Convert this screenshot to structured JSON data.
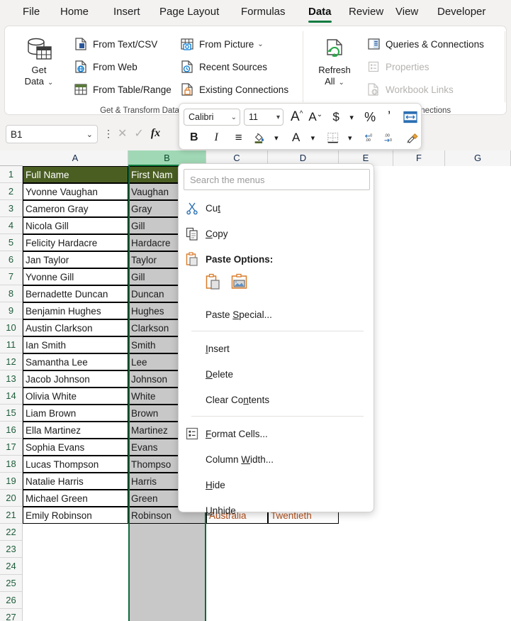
{
  "ribbon": {
    "tabs": [
      {
        "label": "File",
        "active": false
      },
      {
        "label": "Home",
        "active": false
      },
      {
        "label": "Insert",
        "active": false
      },
      {
        "label": "Page Layout",
        "active": false
      },
      {
        "label": "Formulas",
        "active": false
      },
      {
        "label": "Data",
        "active": true
      },
      {
        "label": "Review",
        "active": false
      },
      {
        "label": "View",
        "active": false
      },
      {
        "label": "Developer",
        "active": false
      }
    ],
    "groups": [
      {
        "label": "Get & Transform Data"
      },
      {
        "label": "Queries & Connections"
      }
    ],
    "get_data": {
      "line1": "Get",
      "line2": "Data",
      "chevron": "⌄",
      "icon": "get-data-icon"
    },
    "get_transform_items": [
      {
        "label": "From Text/CSV",
        "icon": "text-csv-icon",
        "disabled": false
      },
      {
        "label": "From Web",
        "icon": "web-icon",
        "disabled": false
      },
      {
        "label": "From Table/Range",
        "icon": "table-range-icon",
        "disabled": false
      },
      {
        "label": "From Picture",
        "icon": "picture-icon",
        "disabled": false,
        "chevron": "⌄"
      },
      {
        "label": "Recent Sources",
        "icon": "recent-sources-icon",
        "disabled": false
      },
      {
        "label": "Existing Connections",
        "icon": "existing-connections-icon",
        "disabled": false
      }
    ],
    "refresh_all": {
      "line1": "Refresh",
      "line2": "All",
      "chevron": "⌄",
      "icon": "refresh-icon"
    },
    "queries_items": [
      {
        "label": "Queries & Connections",
        "icon": "queries-connections-icon",
        "disabled": false
      },
      {
        "label": "Properties",
        "icon": "properties-icon",
        "disabled": true
      },
      {
        "label": "Workbook Links",
        "icon": "workbook-links-icon",
        "disabled": true
      }
    ]
  },
  "formula_bar": {
    "name_box_value": "B1",
    "name_box_chevron": "⌄",
    "cancel_icon": "close-icon",
    "confirm_icon": "check-icon",
    "function_icon": "fx",
    "formula_value": ""
  },
  "mini_toolbar": {
    "font_name": "Calibri",
    "font_size": "11",
    "chevron": "⌄",
    "row1": [
      {
        "name": "increase-font-size-button",
        "glyph": "A˄"
      },
      {
        "name": "decrease-font-size-button",
        "glyph": "Aˇ"
      },
      {
        "name": "accounting-number-format-button",
        "glyph": "$"
      },
      {
        "name": "accounting-format-dropdown",
        "glyph": "⌄"
      },
      {
        "name": "percent-style-button",
        "glyph": "%"
      },
      {
        "name": "comma-style-button",
        "glyph": "'"
      },
      {
        "name": "merge-and-center-button",
        "glyph": "↔"
      }
    ],
    "row2": [
      {
        "name": "bold-button",
        "glyph": "B"
      },
      {
        "name": "italic-button",
        "glyph": "I"
      },
      {
        "name": "align-button",
        "glyph": "≡"
      },
      {
        "name": "fill-color-button",
        "glyph": "◆"
      },
      {
        "name": "fill-color-dropdown",
        "glyph": "⌄"
      },
      {
        "name": "font-color-button",
        "glyph": "A"
      },
      {
        "name": "font-color-dropdown",
        "glyph": "⌄"
      },
      {
        "name": "borders-button",
        "glyph": "⊞"
      },
      {
        "name": "borders-dropdown",
        "glyph": "⌄"
      },
      {
        "name": "increase-decimal-button",
        "glyph": ".00"
      },
      {
        "name": "decrease-decimal-button",
        "glyph": ".0"
      },
      {
        "name": "format-painter-button",
        "glyph": "✎"
      }
    ]
  },
  "context_menu": {
    "search_placeholder": "Search the menus",
    "items": [
      {
        "label": "Cut",
        "icon": "cut-icon",
        "underline": "t",
        "type": "item"
      },
      {
        "label": "Copy",
        "icon": "copy-icon",
        "underline": "C",
        "type": "item"
      },
      {
        "label": "Paste Options:",
        "icon": "paste-icon",
        "type": "header"
      },
      {
        "label": "",
        "type": "paste-options",
        "options": [
          {
            "name": "paste-keep-source-formatting",
            "icon": "paste-option-icon"
          },
          {
            "name": "paste-picture",
            "icon": "paste-picture-icon"
          }
        ]
      },
      {
        "label": "Paste Special...",
        "icon": "",
        "underline": "S",
        "type": "item"
      },
      {
        "type": "separator"
      },
      {
        "label": "Insert",
        "icon": "",
        "underline": "I",
        "type": "item"
      },
      {
        "label": "Delete",
        "icon": "",
        "underline": "D",
        "type": "item"
      },
      {
        "label": "Clear Contents",
        "icon": "",
        "underline": "n",
        "type": "item"
      },
      {
        "type": "separator"
      },
      {
        "label": "Format Cells...",
        "icon": "format-cells-icon",
        "underline": "F",
        "type": "item"
      },
      {
        "label": "Column Width...",
        "icon": "",
        "underline": "W",
        "type": "item"
      },
      {
        "label": "Hide",
        "icon": "",
        "underline": "H",
        "type": "item"
      },
      {
        "label": "Unhide",
        "icon": "",
        "underline": "U",
        "type": "item"
      }
    ]
  },
  "sheet": {
    "columns": [
      "A",
      "B",
      "C",
      "D",
      "E",
      "F",
      "G"
    ],
    "selected_column": "B",
    "rows": [
      1,
      2,
      3,
      4,
      5,
      6,
      7,
      8,
      9,
      10,
      11,
      12,
      13,
      14,
      15,
      16,
      17,
      18,
      19,
      20,
      21,
      22,
      23,
      24,
      25,
      26,
      27
    ],
    "header_row": {
      "A": "Full Name",
      "B": "First Nam"
    },
    "data": [
      {
        "row": 2,
        "A": "Yvonne Vaughan",
        "B": "Vaughan"
      },
      {
        "row": 3,
        "A": "Cameron Gray",
        "B": "Gray"
      },
      {
        "row": 4,
        "A": "Nicola Gill",
        "B": "Gill"
      },
      {
        "row": 5,
        "A": "Felicity Hardacre",
        "B": "Hardacre"
      },
      {
        "row": 6,
        "A": "Jan Taylor",
        "B": "Taylor"
      },
      {
        "row": 7,
        "A": "Yvonne Gill",
        "B": "Gill"
      },
      {
        "row": 8,
        "A": "Bernadette Duncan",
        "B": "Duncan"
      },
      {
        "row": 9,
        "A": "Benjamin Hughes",
        "B": "Hughes"
      },
      {
        "row": 10,
        "A": "Austin Clarkson",
        "B": "Clarkson"
      },
      {
        "row": 11,
        "A": "Ian Smith",
        "B": "Smith"
      },
      {
        "row": 12,
        "A": "Samantha Lee",
        "B": "Lee"
      },
      {
        "row": 13,
        "A": "Jacob Johnson",
        "B": "Johnson"
      },
      {
        "row": 14,
        "A": "Olivia White",
        "B": "White"
      },
      {
        "row": 15,
        "A": "Liam Brown",
        "B": "Brown"
      },
      {
        "row": 16,
        "A": "Ella Martinez",
        "B": "Martinez"
      },
      {
        "row": 17,
        "A": "Sophia Evans",
        "B": "Evans"
      },
      {
        "row": 18,
        "A": "Lucas Thompson",
        "B": "Thompso"
      },
      {
        "row": 19,
        "A": "Natalie Harris",
        "B": "Harris"
      },
      {
        "row": 20,
        "A": "Michael Green",
        "B": "Green"
      },
      {
        "row": 21,
        "A": "Emily Robinson",
        "B": "Robinson",
        "C": "Australia",
        "D": "Twentieth"
      }
    ]
  },
  "colors": {
    "accent_green": "#107c41",
    "header_band": "#4a5e22",
    "selection_gray": "#c8c8c8",
    "col_header_selected": "#a0d8b5",
    "orange_text": "#b4501a"
  }
}
